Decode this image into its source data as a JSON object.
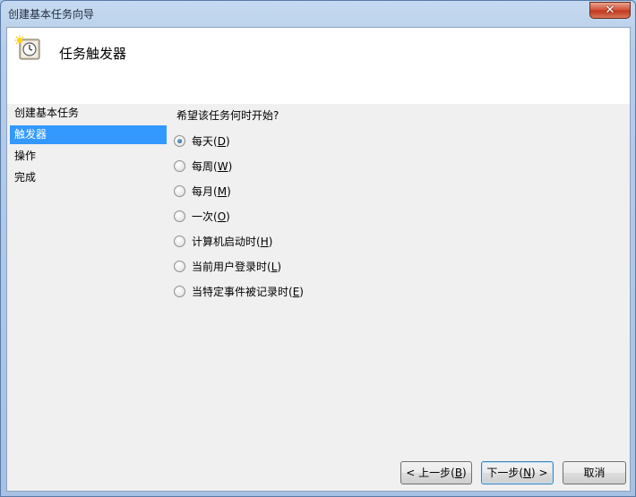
{
  "window": {
    "title": "创建基本任务向导",
    "close_label": "✕"
  },
  "header": {
    "title": "任务触发器",
    "icon": "task-scheduler-clock-icon"
  },
  "sidebar": {
    "items": [
      {
        "label": "创建基本任务",
        "selected": false
      },
      {
        "label": "触发器",
        "selected": true
      },
      {
        "label": "操作",
        "selected": false
      },
      {
        "label": "完成",
        "selected": false
      }
    ]
  },
  "main": {
    "prompt": "希望该任务何时开始?",
    "options": [
      {
        "text": "每天",
        "mnemonic": "D",
        "checked": true
      },
      {
        "text": "每周",
        "mnemonic": "W",
        "checked": false
      },
      {
        "text": "每月",
        "mnemonic": "M",
        "checked": false
      },
      {
        "text": "一次",
        "mnemonic": "O",
        "checked": false
      },
      {
        "text": "计算机启动时",
        "mnemonic": "H",
        "checked": false
      },
      {
        "text": "当前用户登录时",
        "mnemonic": "L",
        "checked": false
      },
      {
        "text": "当特定事件被记录时",
        "mnemonic": "E",
        "checked": false
      }
    ]
  },
  "buttons": {
    "back": {
      "prefix": "< 上一步(",
      "mnemonic": "B",
      "suffix": ")"
    },
    "next": {
      "prefix": "下一步(",
      "mnemonic": "N",
      "suffix": ") >"
    },
    "cancel": {
      "label": "取消"
    }
  }
}
